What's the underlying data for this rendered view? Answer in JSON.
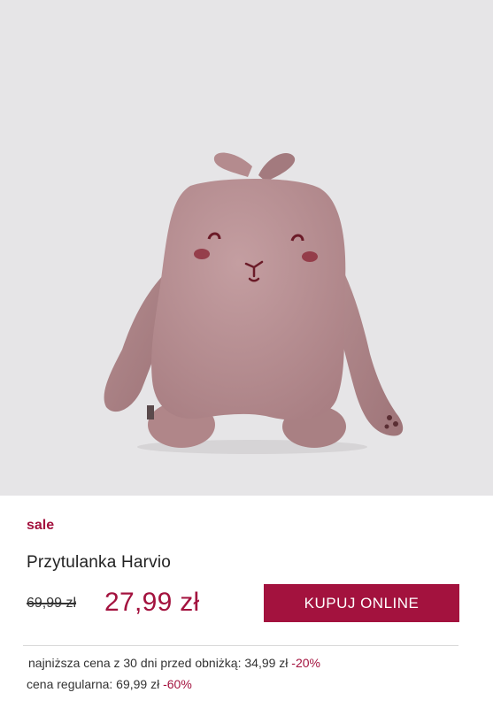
{
  "product": {
    "badge": "sale",
    "name": "Przytulanka Harvio",
    "old_price": "69,99 zł",
    "new_price": "27,99 zł",
    "buy_button_label": "KUPUJ ONLINE",
    "image_alt": "plush-bunny-toy"
  },
  "price_info": {
    "lowest_label": "najniższa cena z 30 dni przed obniżką: 34,99 zł",
    "lowest_discount": "-20%",
    "regular_label": "cena regularna: 69,99 zł",
    "regular_discount": "-60%"
  },
  "colors": {
    "accent": "#a3123e",
    "image_background": "#e6e5e7",
    "plush": "#b98d90"
  }
}
